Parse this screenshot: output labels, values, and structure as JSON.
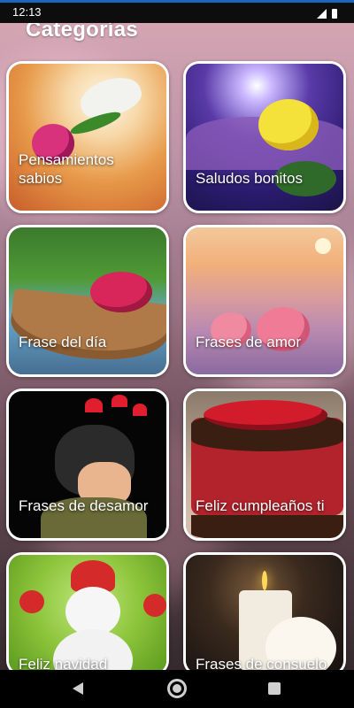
{
  "status_bar": {
    "time": "12:13"
  },
  "header": {
    "title": "Categorías"
  },
  "categories": [
    {
      "label": "Pensamientos sabios"
    },
    {
      "label": "Saludos bonitos"
    },
    {
      "label": "Frase del día"
    },
    {
      "label": "Frases de amor"
    },
    {
      "label": "Frases de desamor"
    },
    {
      "label": "Feliz cumpleaños ti"
    },
    {
      "label": "Feliz navidad"
    },
    {
      "label": "Frases de consuelo"
    }
  ],
  "colors": {
    "card_border": "#ffffff",
    "status_accent": "#1766c2",
    "nav_bg": "#000000"
  }
}
